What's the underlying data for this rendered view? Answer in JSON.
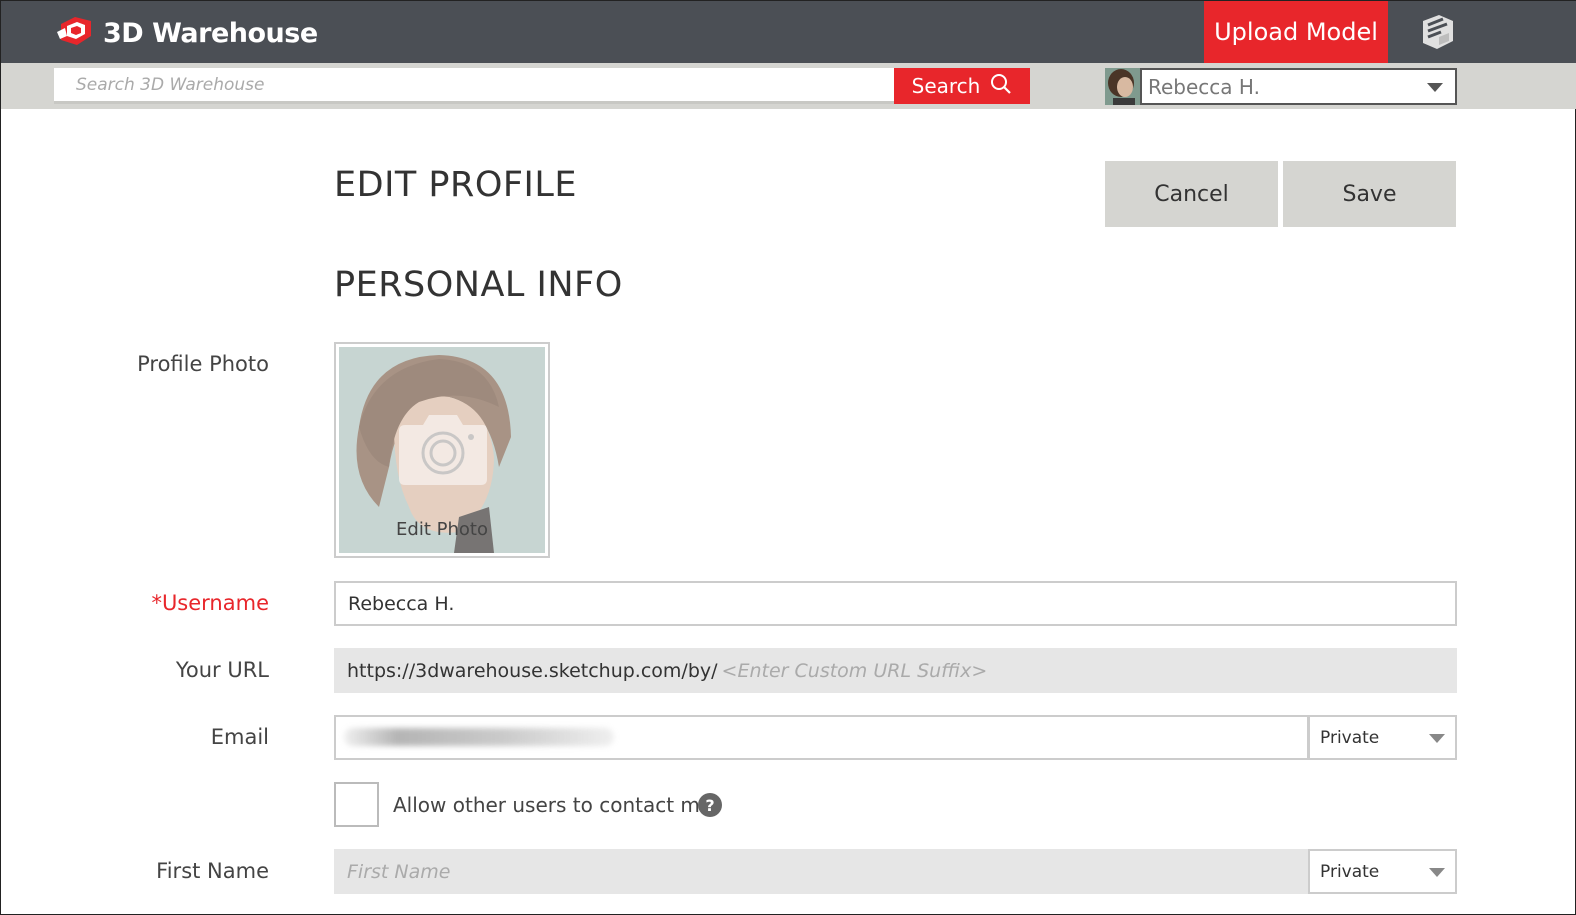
{
  "header": {
    "logo_text": "3D Warehouse",
    "upload_label": "Upload Model",
    "brand_color": "#e8262b",
    "bar_color": "#4b4f55"
  },
  "search": {
    "placeholder": "Search 3D Warehouse",
    "button_label": "Search"
  },
  "user_menu": {
    "name": "Rebecca H."
  },
  "page": {
    "title": "EDIT PROFILE",
    "cancel_label": "Cancel",
    "save_label": "Save",
    "section_title": "PERSONAL INFO"
  },
  "form": {
    "profile_photo_label": "Profile Photo",
    "edit_photo_label": "Edit Photo",
    "username_label": "*Username",
    "username_value": "Rebecca H.",
    "url_label": "Your URL",
    "url_prefix": "https://3dwarehouse.sketchup.com/by/",
    "url_suffix_placeholder": "<Enter Custom URL Suffix>",
    "email_label": "Email",
    "email_privacy": "Private",
    "contact_label": "Allow other users to contact me",
    "contact_checked": false,
    "help_glyph": "?",
    "first_name_label": "First Name",
    "first_name_placeholder": "First Name",
    "first_name_privacy": "Private"
  }
}
